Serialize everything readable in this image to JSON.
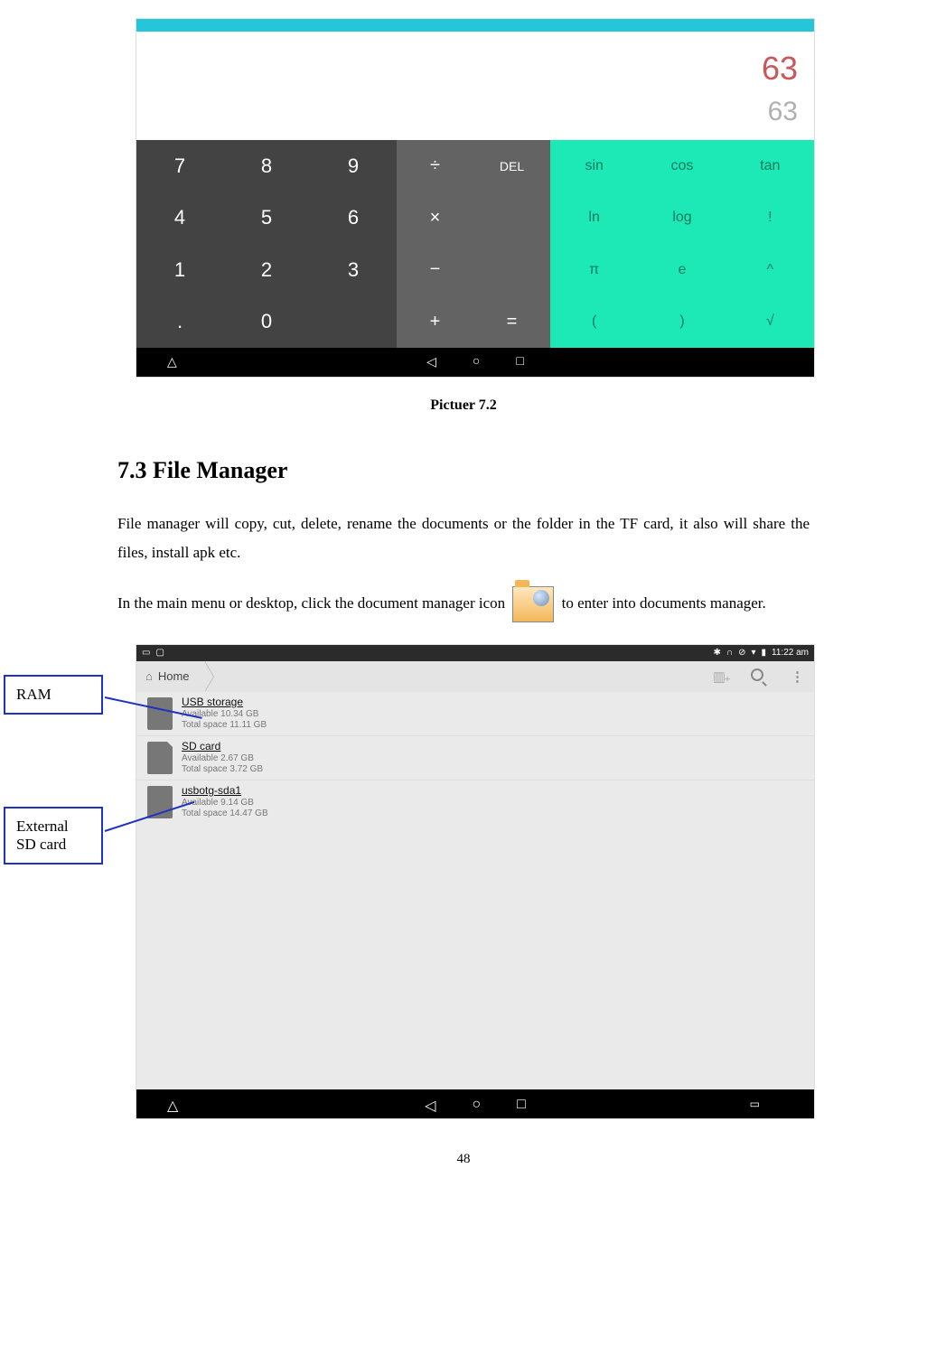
{
  "calculator": {
    "formula": "63",
    "result": "63",
    "numpad": [
      "7",
      "8",
      "9",
      "4",
      "5",
      "6",
      "1",
      "2",
      "3",
      ".",
      "0",
      ""
    ],
    "ops": [
      [
        "÷",
        "DEL"
      ],
      [
        "×",
        ""
      ],
      [
        "−",
        ""
      ],
      [
        "+",
        "="
      ]
    ],
    "sci": [
      [
        "sin",
        "cos",
        "tan"
      ],
      [
        "ln",
        "log",
        "!"
      ],
      [
        "π",
        "e",
        "^"
      ],
      [
        "(",
        ")",
        "√"
      ]
    ]
  },
  "caption1": "Pictuer 7.2",
  "heading": "7.3 File Manager",
  "para1": "File manager will copy, cut, delete, rename the documents or the folder in the TF card, it also will share the files, install apk etc.",
  "para2_pre": "In the main menu or desktop, click the document manager icon ",
  "para2_post": " to enter into documents manager.",
  "callouts": {
    "ram": "RAM",
    "sd": "External SD card"
  },
  "filemanager": {
    "status_time": "11:22 am",
    "breadcrumb": "Home",
    "items": [
      {
        "title": "USB storage",
        "avail": "Available 10.34 GB",
        "total": "Total space 11.11 GB",
        "icon": "phone"
      },
      {
        "title": "SD card",
        "avail": "Available 2.67 GB",
        "total": "Total space 3.72 GB",
        "icon": "sd"
      },
      {
        "title": "usbotg-sda1",
        "avail": "Available 9.14 GB",
        "total": "Total space 14.47 GB",
        "icon": "phone"
      }
    ]
  },
  "page_number": "48"
}
